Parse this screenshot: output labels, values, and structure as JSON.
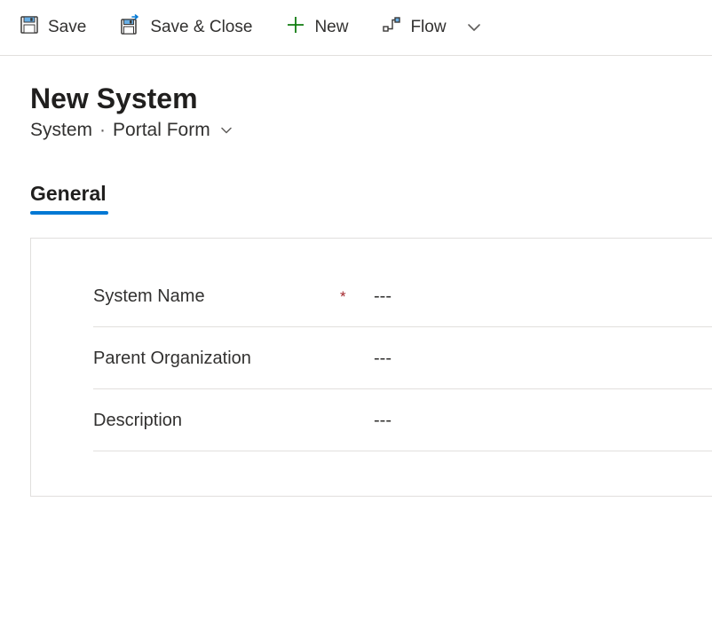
{
  "toolbar": {
    "save_label": "Save",
    "save_close_label": "Save & Close",
    "new_label": "New",
    "flow_label": "Flow"
  },
  "header": {
    "title": "New System",
    "entity": "System",
    "form_name": "Portal Form"
  },
  "tabs": {
    "general": "General"
  },
  "form": {
    "system_name": {
      "label": "System Name",
      "required": "*",
      "value": "---"
    },
    "parent_org": {
      "label": "Parent Organization",
      "required": "",
      "value": "---"
    },
    "description": {
      "label": "Description",
      "required": "",
      "value": "---"
    }
  }
}
